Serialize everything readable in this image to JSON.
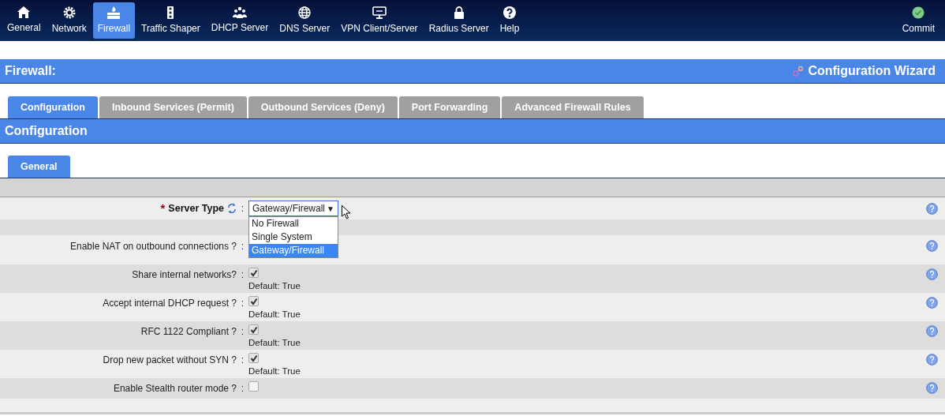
{
  "nav": [
    {
      "label": "General",
      "selected": false
    },
    {
      "label": "Network",
      "selected": false
    },
    {
      "label": "Firewall",
      "selected": true
    },
    {
      "label": "Traffic Shaper",
      "selected": false
    },
    {
      "label": "DHCP Server",
      "selected": false
    },
    {
      "label": "DNS Server",
      "selected": false
    },
    {
      "label": "VPN Client/Server",
      "selected": false
    },
    {
      "label": "Radius Server",
      "selected": false
    },
    {
      "label": "Help",
      "selected": false
    }
  ],
  "commit": {
    "label": "Commit"
  },
  "page_title": "Firewall:",
  "wizard": "Configuration Wizard",
  "tabs": [
    {
      "label": "Configuration",
      "selected": true
    },
    {
      "label": "Inbound Services (Permit)",
      "selected": false
    },
    {
      "label": "Outbound Services (Deny)",
      "selected": false
    },
    {
      "label": "Port Forwarding",
      "selected": false
    },
    {
      "label": "Advanced Firewall Rules",
      "selected": false
    }
  ],
  "section_title": "Configuration",
  "subtabs": [
    {
      "label": "General",
      "selected": true
    }
  ],
  "rows": [
    {
      "kind": "select",
      "label": "Server Type",
      "required_mark": "*",
      "separator": ":",
      "value": "Gateway/Firewall",
      "arrow": "▼",
      "expanded": true,
      "options": [
        {
          "label": "No Firewall",
          "selected": false
        },
        {
          "label": "Single System",
          "selected": false
        },
        {
          "label": "Gateway/Firewall",
          "selected": true
        }
      ]
    },
    {
      "kind": "spacer"
    },
    {
      "kind": "hidden",
      "label": "Enable NAT on outbound connections ?",
      "separator": ":"
    },
    {
      "kind": "checkbox",
      "label": "Share internal networks?",
      "separator": ":",
      "checked": true,
      "default": "Default: True"
    },
    {
      "kind": "checkbox",
      "label": "Accept internal DHCP request ?",
      "separator": ":",
      "checked": true,
      "default": "Default: True"
    },
    {
      "kind": "checkbox",
      "label": "RFC 1122 Compliant ?",
      "separator": ":",
      "checked": true,
      "default": "Default: True"
    },
    {
      "kind": "checkbox",
      "label": "Drop new packet without SYN ?",
      "separator": ":",
      "checked": true,
      "default": "Default: True"
    },
    {
      "kind": "checkbox",
      "label": "Enable Stealth router mode ?",
      "separator": ":",
      "checked": false
    }
  ]
}
